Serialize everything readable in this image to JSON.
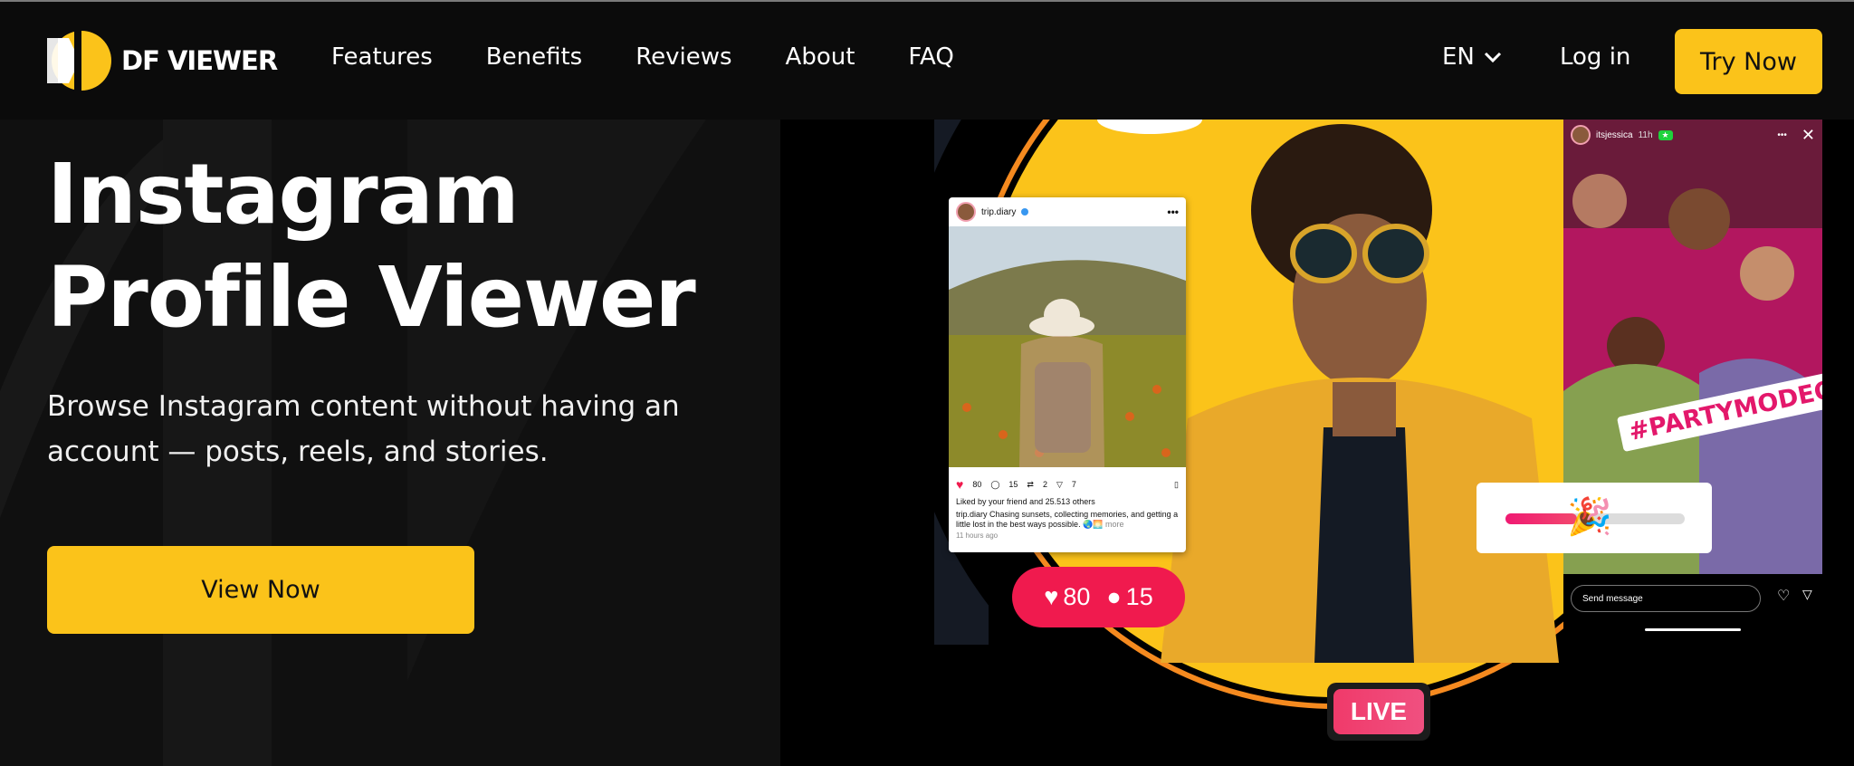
{
  "brand": {
    "name": "DF VIEWER"
  },
  "nav": {
    "items": [
      "Features",
      "Benefits",
      "Reviews",
      "About",
      "FAQ"
    ],
    "language": "EN",
    "login": "Log in",
    "cta": "Try Now"
  },
  "hero": {
    "title": "Instagram Profile Viewer",
    "subtitle": "Browse Instagram content without having an account — posts, reels, and stories.",
    "cta": "View Now"
  },
  "post": {
    "username": "trip.diary",
    "likes": "80",
    "comments": "15",
    "reposts": "2",
    "shares": "7",
    "liked_by_prefix": "Liked by",
    "liked_by_name": "your friend",
    "liked_by_mid": "and",
    "liked_by_count": "25.513",
    "liked_by_suffix": "others",
    "caption_user": "trip.diary",
    "caption": "Chasing sunsets, collecting memories, and getting a little lost in the best ways possible. 🌏🌅",
    "caption_more": "more",
    "time": "11 hours ago"
  },
  "counter": {
    "likes": "80",
    "comments": "15"
  },
  "live_badge": "LIVE",
  "story": {
    "username": "itsjessica",
    "age": "11h",
    "sticker": "#PARTYMODEON",
    "send_placeholder": "Send message"
  },
  "poll": {
    "emoji": "🎉",
    "fraction": 0.4
  },
  "colors": {
    "accent": "#fbc31a",
    "like_red": "#f01a4e",
    "pink": "#e3186b"
  }
}
